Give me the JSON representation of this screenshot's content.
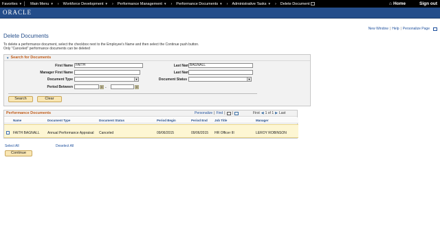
{
  "nav": {
    "menus": [
      "Favorites",
      "Main Menu",
      "Workforce Development",
      "Performance Management",
      "Performance Documents",
      "Administrative Tasks",
      "Delete Document"
    ],
    "home": "Home",
    "signout": "Sign out"
  },
  "brand": {
    "logo": "ORACLE"
  },
  "util": {
    "new_window": "New Window",
    "help": "Help",
    "personalize_page": "Personalize Page"
  },
  "page": {
    "title": "Delete Documents",
    "instructions": [
      "To delete a performance document, select the checkbox next to the Employee's Name and then select the Continue push button.",
      "Only \"Canceled\" performance documents can be deleted"
    ]
  },
  "search": {
    "header": "Search for Documents",
    "first_name_label": "First Name",
    "first_name_value": "FAITH",
    "last_name_label": "Last Name",
    "last_name_value": "BAGNALL",
    "manager_first_label": "Manager First Name",
    "manager_first_value": "",
    "manager_last_label": "Last Name",
    "manager_last_value": "",
    "doc_type_label": "Document Type",
    "doc_type_value": "",
    "doc_status_label": "Document Status",
    "doc_status_value": "",
    "period_label": "Period Between",
    "period_from": "",
    "period_to": "",
    "dash": "-",
    "search_button": "Search",
    "clear_button": "Clear"
  },
  "grid": {
    "title": "Performance Documents",
    "personalize": "Personalize",
    "find": "Find",
    "first": "First",
    "pager": "1 of 1",
    "last": "Last",
    "columns": [
      "Name",
      "Document Type",
      "Document Status",
      "Period Begin",
      "Period End",
      "Job Title",
      "Manager"
    ],
    "rows": [
      {
        "name": "FAITH BAGNALL",
        "doc_type": "Annual Performance Appraisal",
        "doc_status": "Canceled",
        "period_begin": "09/06/2015",
        "period_end": "09/06/2015",
        "job_title": "HR Officer III",
        "manager": "LEROY ROBINSON"
      }
    ]
  },
  "actions": {
    "select_all": "Select All",
    "deselect_all": "Deselect All",
    "continue": "Continue"
  }
}
